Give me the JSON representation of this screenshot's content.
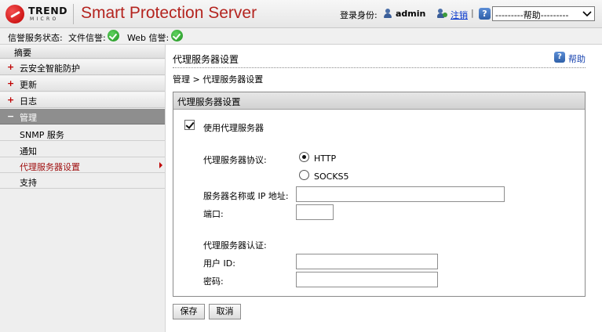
{
  "header": {
    "logo_text": "TREND",
    "logo_subtext": "MICRO",
    "app_title": "Smart Protection Server",
    "login_label": "登录身份:",
    "username": "admin",
    "logout": "注销",
    "separator": "|",
    "help_select_value": "---------帮助---------"
  },
  "status": {
    "label": "信誉服务状态:",
    "file_label": "文件信誉:",
    "web_label": "Web 信誉:"
  },
  "sidebar": {
    "summary": "摘要",
    "groups": [
      {
        "icon": "+",
        "label": "云安全智能防护"
      },
      {
        "icon": "+",
        "label": "更新"
      },
      {
        "icon": "+",
        "label": "日志"
      },
      {
        "icon": "−",
        "label": "管理"
      }
    ],
    "sub_items": [
      {
        "label": "SNMP 服务"
      },
      {
        "label": "通知"
      },
      {
        "label": "代理服务器设置"
      },
      {
        "label": "支持"
      }
    ]
  },
  "main": {
    "page_title": "代理服务器设置",
    "help": "帮助",
    "breadcrumb": "管理 > 代理服务器设置",
    "panel_title": "代理服务器设置",
    "use_proxy_label": "使用代理服务器",
    "protocol_label": "代理服务器协议:",
    "protocols": [
      "HTTP",
      "SOCKS5"
    ],
    "server_label": "服务器名称或 IP 地址:",
    "server_value": "",
    "port_label": "端口:",
    "port_value": "",
    "auth_label": "代理服务器认证:",
    "userid_label": "用户 ID:",
    "userid_value": "",
    "password_label": "密码:",
    "password_value": ""
  },
  "buttons": {
    "save": "保存",
    "cancel": "取消"
  }
}
